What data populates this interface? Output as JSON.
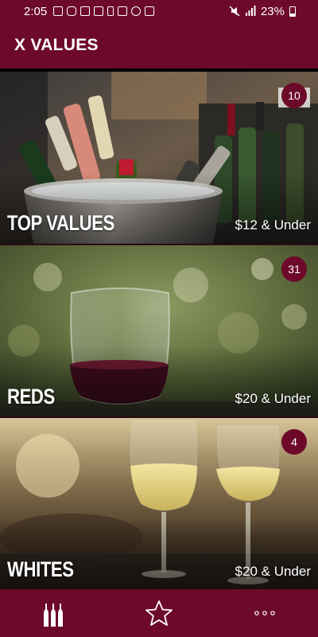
{
  "status_bar": {
    "time": "2:05",
    "battery": "23%",
    "icons": [
      "calendar-icon",
      "instagram-icon",
      "photo-icon",
      "mail-icon",
      "nba-icon",
      "photo-icon",
      "weather-icon",
      "gallery-icon",
      "mute-icon",
      "signal-icon",
      "battery-icon"
    ]
  },
  "app_bar": {
    "title": "X VALUES"
  },
  "categories": [
    {
      "name": "TOP VALUES",
      "price": "$12 & Under",
      "count": "10"
    },
    {
      "name": "REDS",
      "price": "$20 & Under",
      "count": "31"
    },
    {
      "name": "WHITES",
      "price": "$20 & Under",
      "count": "4"
    }
  ],
  "bottom_nav": {
    "items": [
      "wine-bottles-icon",
      "star-icon",
      "more-icon"
    ]
  },
  "colors": {
    "brand": "#6d0a2a"
  }
}
